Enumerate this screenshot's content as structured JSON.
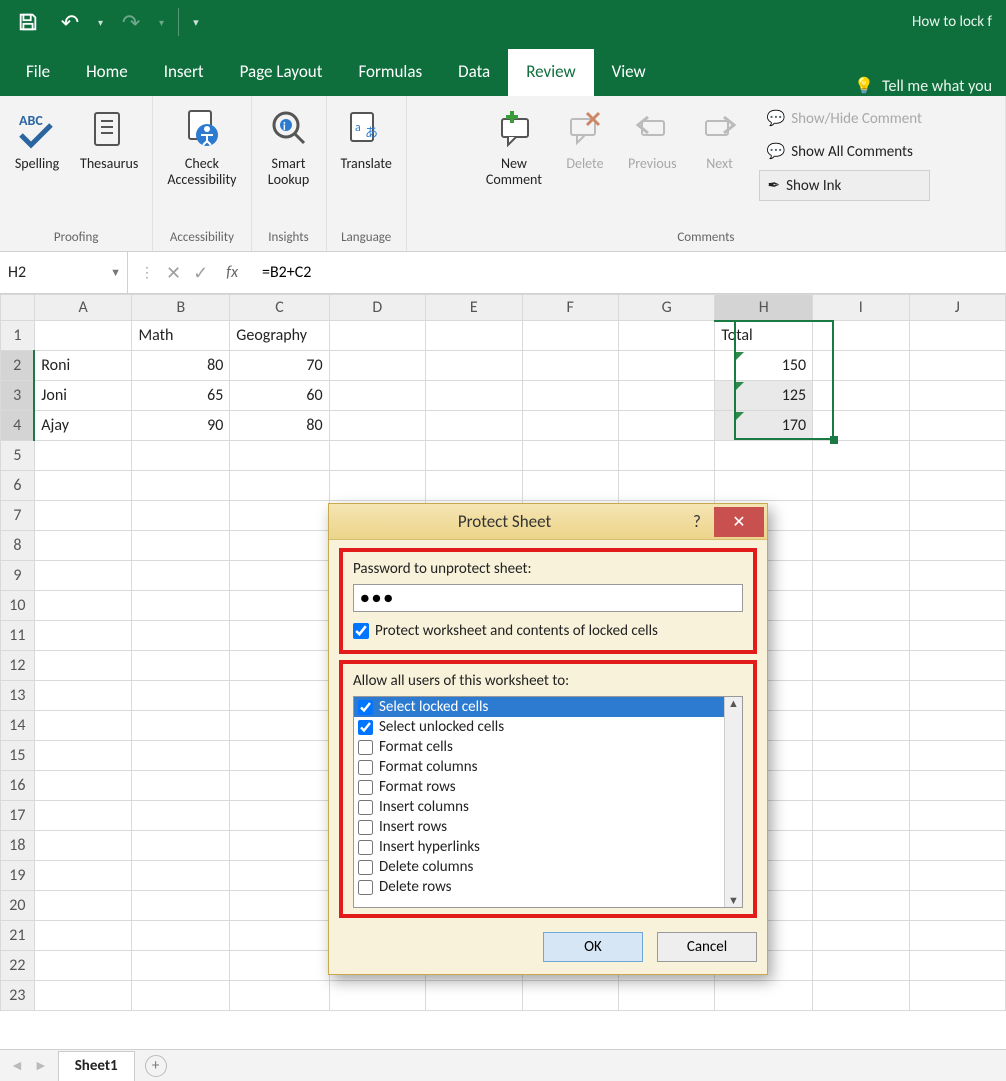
{
  "title_bar_right": "How to lock f",
  "tabs": [
    "File",
    "Home",
    "Insert",
    "Page Layout",
    "Formulas",
    "Data",
    "Review",
    "View"
  ],
  "active_tab": "Review",
  "tell_me": "Tell me what you",
  "ribbon": {
    "proofing": {
      "label": "Proofing",
      "spelling": "Spelling",
      "thesaurus": "Thesaurus"
    },
    "accessibility": {
      "label": "Accessibility",
      "check": "Check\nAccessibility"
    },
    "insights": {
      "label": "Insights",
      "smart": "Smart\nLookup"
    },
    "language": {
      "label": "Language",
      "translate": "Translate"
    },
    "comments": {
      "label": "Comments",
      "new": "New\nComment",
      "delete": "Delete",
      "previous": "Previous",
      "next": "Next",
      "show_hide": "Show/Hide Comment",
      "show_all": "Show All Comments",
      "show_ink": "Show Ink"
    }
  },
  "name_box": "H2",
  "formula": "=B2+C2",
  "columns": [
    "A",
    "B",
    "C",
    "D",
    "E",
    "F",
    "G",
    "H",
    "I",
    "J"
  ],
  "rows": 23,
  "cells": {
    "B1": "Math",
    "C1": "Geography",
    "H1": "Total",
    "A2": "Roni",
    "B2": "80",
    "C2": "70",
    "H2": "150",
    "A3": "Joni",
    "B3": "65",
    "C3": "60",
    "H3": "125",
    "A4": "Ajay",
    "B4": "90",
    "C4": "80",
    "H4": "170"
  },
  "selected_range": "H2:H4",
  "dialog": {
    "title": "Protect Sheet",
    "password_label": "Password to unprotect sheet:",
    "password_value": "●●●",
    "protect_chk": "Protect worksheet and contents of locked cells",
    "allow_label": "Allow all users of this worksheet to:",
    "options": [
      {
        "label": "Select locked cells",
        "checked": true,
        "selected": true
      },
      {
        "label": "Select unlocked cells",
        "checked": true,
        "selected": false
      },
      {
        "label": "Format cells",
        "checked": false,
        "selected": false
      },
      {
        "label": "Format columns",
        "checked": false,
        "selected": false
      },
      {
        "label": "Format rows",
        "checked": false,
        "selected": false
      },
      {
        "label": "Insert columns",
        "checked": false,
        "selected": false
      },
      {
        "label": "Insert rows",
        "checked": false,
        "selected": false
      },
      {
        "label": "Insert hyperlinks",
        "checked": false,
        "selected": false
      },
      {
        "label": "Delete columns",
        "checked": false,
        "selected": false
      },
      {
        "label": "Delete rows",
        "checked": false,
        "selected": false
      }
    ],
    "ok": "OK",
    "cancel": "Cancel"
  },
  "sheet_tab": "Sheet1"
}
